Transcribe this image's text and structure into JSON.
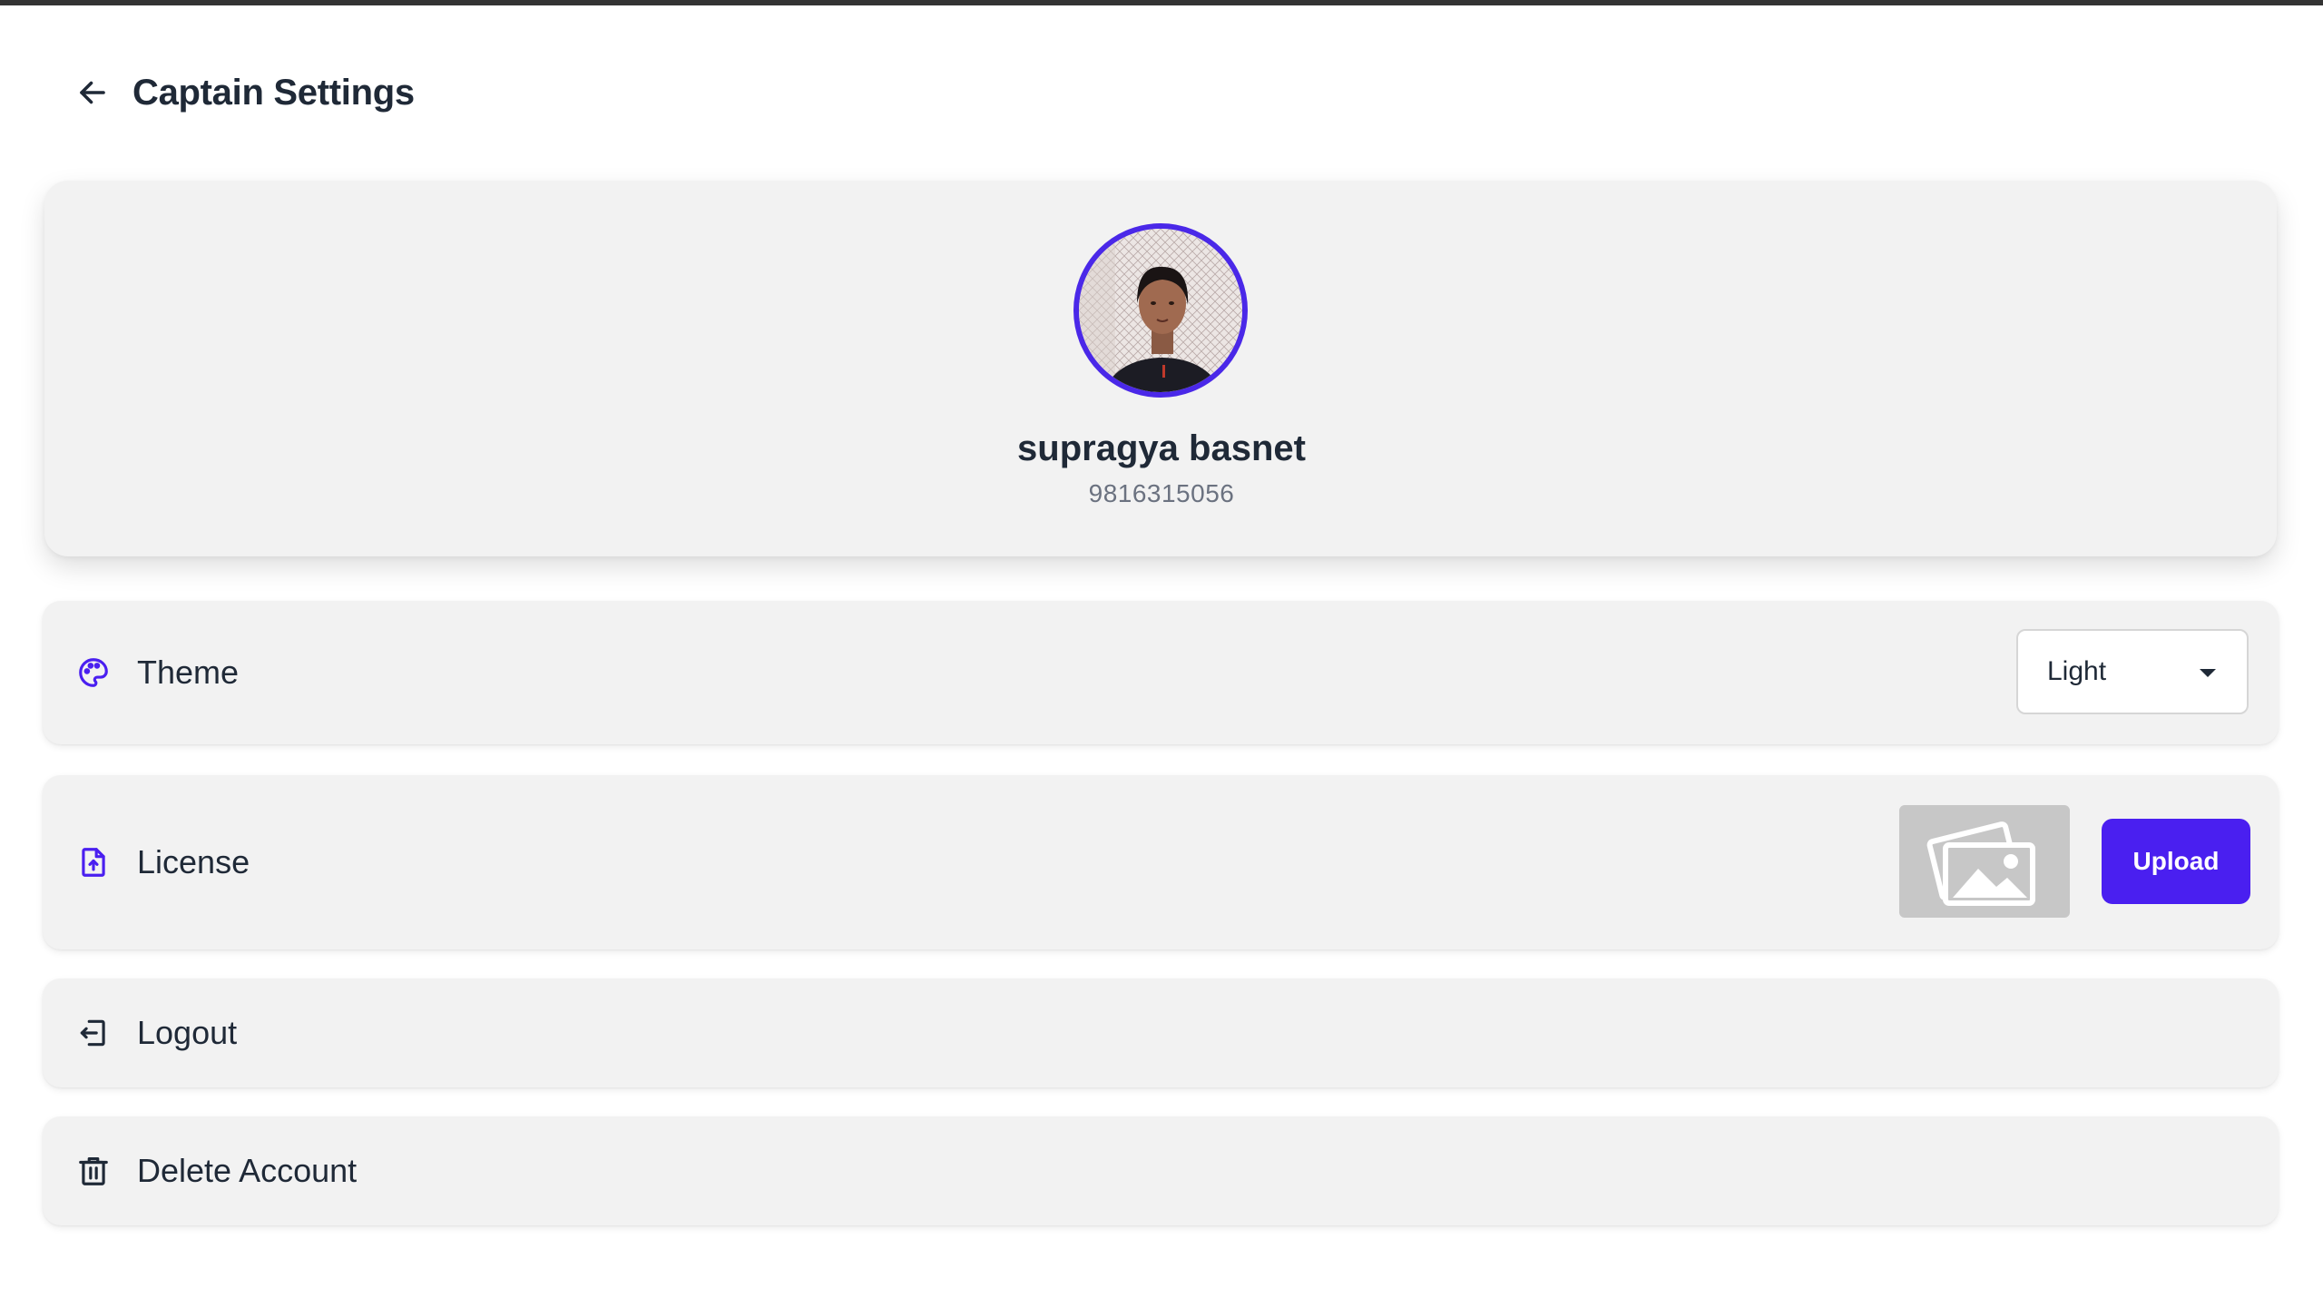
{
  "header": {
    "title": "Captain Settings",
    "back_icon": "arrow-left-icon"
  },
  "profile": {
    "name": "supragya basnet",
    "phone": "9816315056",
    "avatar_ring_color": "#4a28e8"
  },
  "settings": {
    "theme": {
      "label": "Theme",
      "icon": "palette-icon",
      "selected": "Light"
    },
    "license": {
      "label": "License",
      "icon": "file-upload-icon",
      "upload_label": "Upload",
      "thumbnail_icon": "image-placeholder-icon"
    },
    "logout": {
      "label": "Logout",
      "icon": "logout-icon"
    },
    "delete": {
      "label": "Delete Account",
      "icon": "trash-icon"
    }
  },
  "colors": {
    "accent": "#4a1ff0",
    "card_bg": "#f2f2f2",
    "text": "#1f2937",
    "muted": "#6b7280"
  }
}
